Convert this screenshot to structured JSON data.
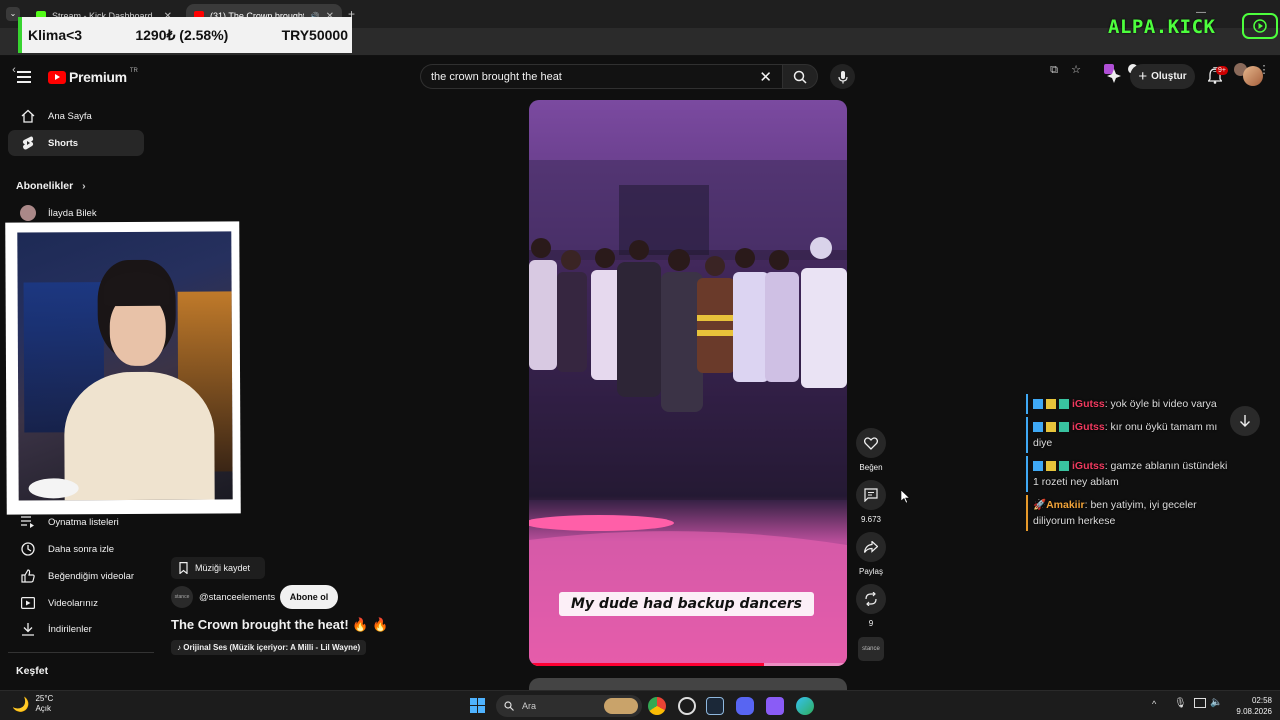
{
  "browser": {
    "tabs": [
      {
        "title": "Stream - Kick Dashboard",
        "icon": "kick-icon",
        "color": "#53fc18"
      },
      {
        "title": "(31) The Crown brought the...",
        "icon": "youtube-icon",
        "color": "#ff0000"
      }
    ],
    "new_tab": "+"
  },
  "overlay": {
    "ticker_name": "Klima<3",
    "ticker_value": "1290₺ (2.58%)",
    "ticker_goal": "TRY50000",
    "brand": "ALPA.KICK",
    "accent": "#4dff3d"
  },
  "youtube": {
    "logo_word": "Premium",
    "logo_region": "TR",
    "search_value": "the crown brought the heat",
    "create_label": "Oluştur",
    "notif_badge": "9+"
  },
  "sidebar": {
    "items_top": [
      {
        "label": "Ana Sayfa",
        "icon": "home-icon"
      },
      {
        "label": "Shorts",
        "icon": "shorts-icon",
        "active": true
      }
    ],
    "subs_heading": "Abonelikler",
    "subs": [
      {
        "label": "İlayda Bilek"
      }
    ],
    "items_you": [
      {
        "label": "Oynatma listeleri",
        "icon": "playlist-icon"
      },
      {
        "label": "Daha sonra izle",
        "icon": "clock-icon"
      },
      {
        "label": "Beğendiğim videolar",
        "icon": "thumbs-up-icon"
      },
      {
        "label": "Videolarınız",
        "icon": "video-icon"
      },
      {
        "label": "İndirilenler",
        "icon": "download-icon"
      }
    ],
    "explore_heading": "Keşfet"
  },
  "short": {
    "caption": "My dude had backup dancers",
    "progress": 0.74,
    "save_music": "Müziği kaydet",
    "channel": "@stanceelements",
    "channel_avatar_text": "stance",
    "subscribe": "Abone ol",
    "title": "The Crown brought the heat! 🔥 🔥",
    "sound": "♪ Orijinal Ses (Müzik içeriyor: A Milli - Lil Wayne)",
    "actions": {
      "like": "Beğen",
      "comments": "9.673",
      "share": "Paylaş",
      "remix": "9"
    }
  },
  "chat": {
    "messages": [
      {
        "user": "iGutss",
        "sep": ":",
        "text": "yok öyle bi video varya"
      },
      {
        "user": "iGutss",
        "sep": ":",
        "text": "kır onu öykü tamam mı diye"
      },
      {
        "user": "iGutss",
        "sep": ":",
        "text": "gamze ablanın üstündeki 1 rozeti ney ablam"
      },
      {
        "user": "Amakiir",
        "sep": ":",
        "text": "ben yatiyim, iyi geceler diliyorum herkese"
      }
    ]
  },
  "taskbar": {
    "temp": "25°C",
    "condition": "Açık",
    "search": "Ara",
    "time": "02:58",
    "date": "9.08.2026"
  }
}
